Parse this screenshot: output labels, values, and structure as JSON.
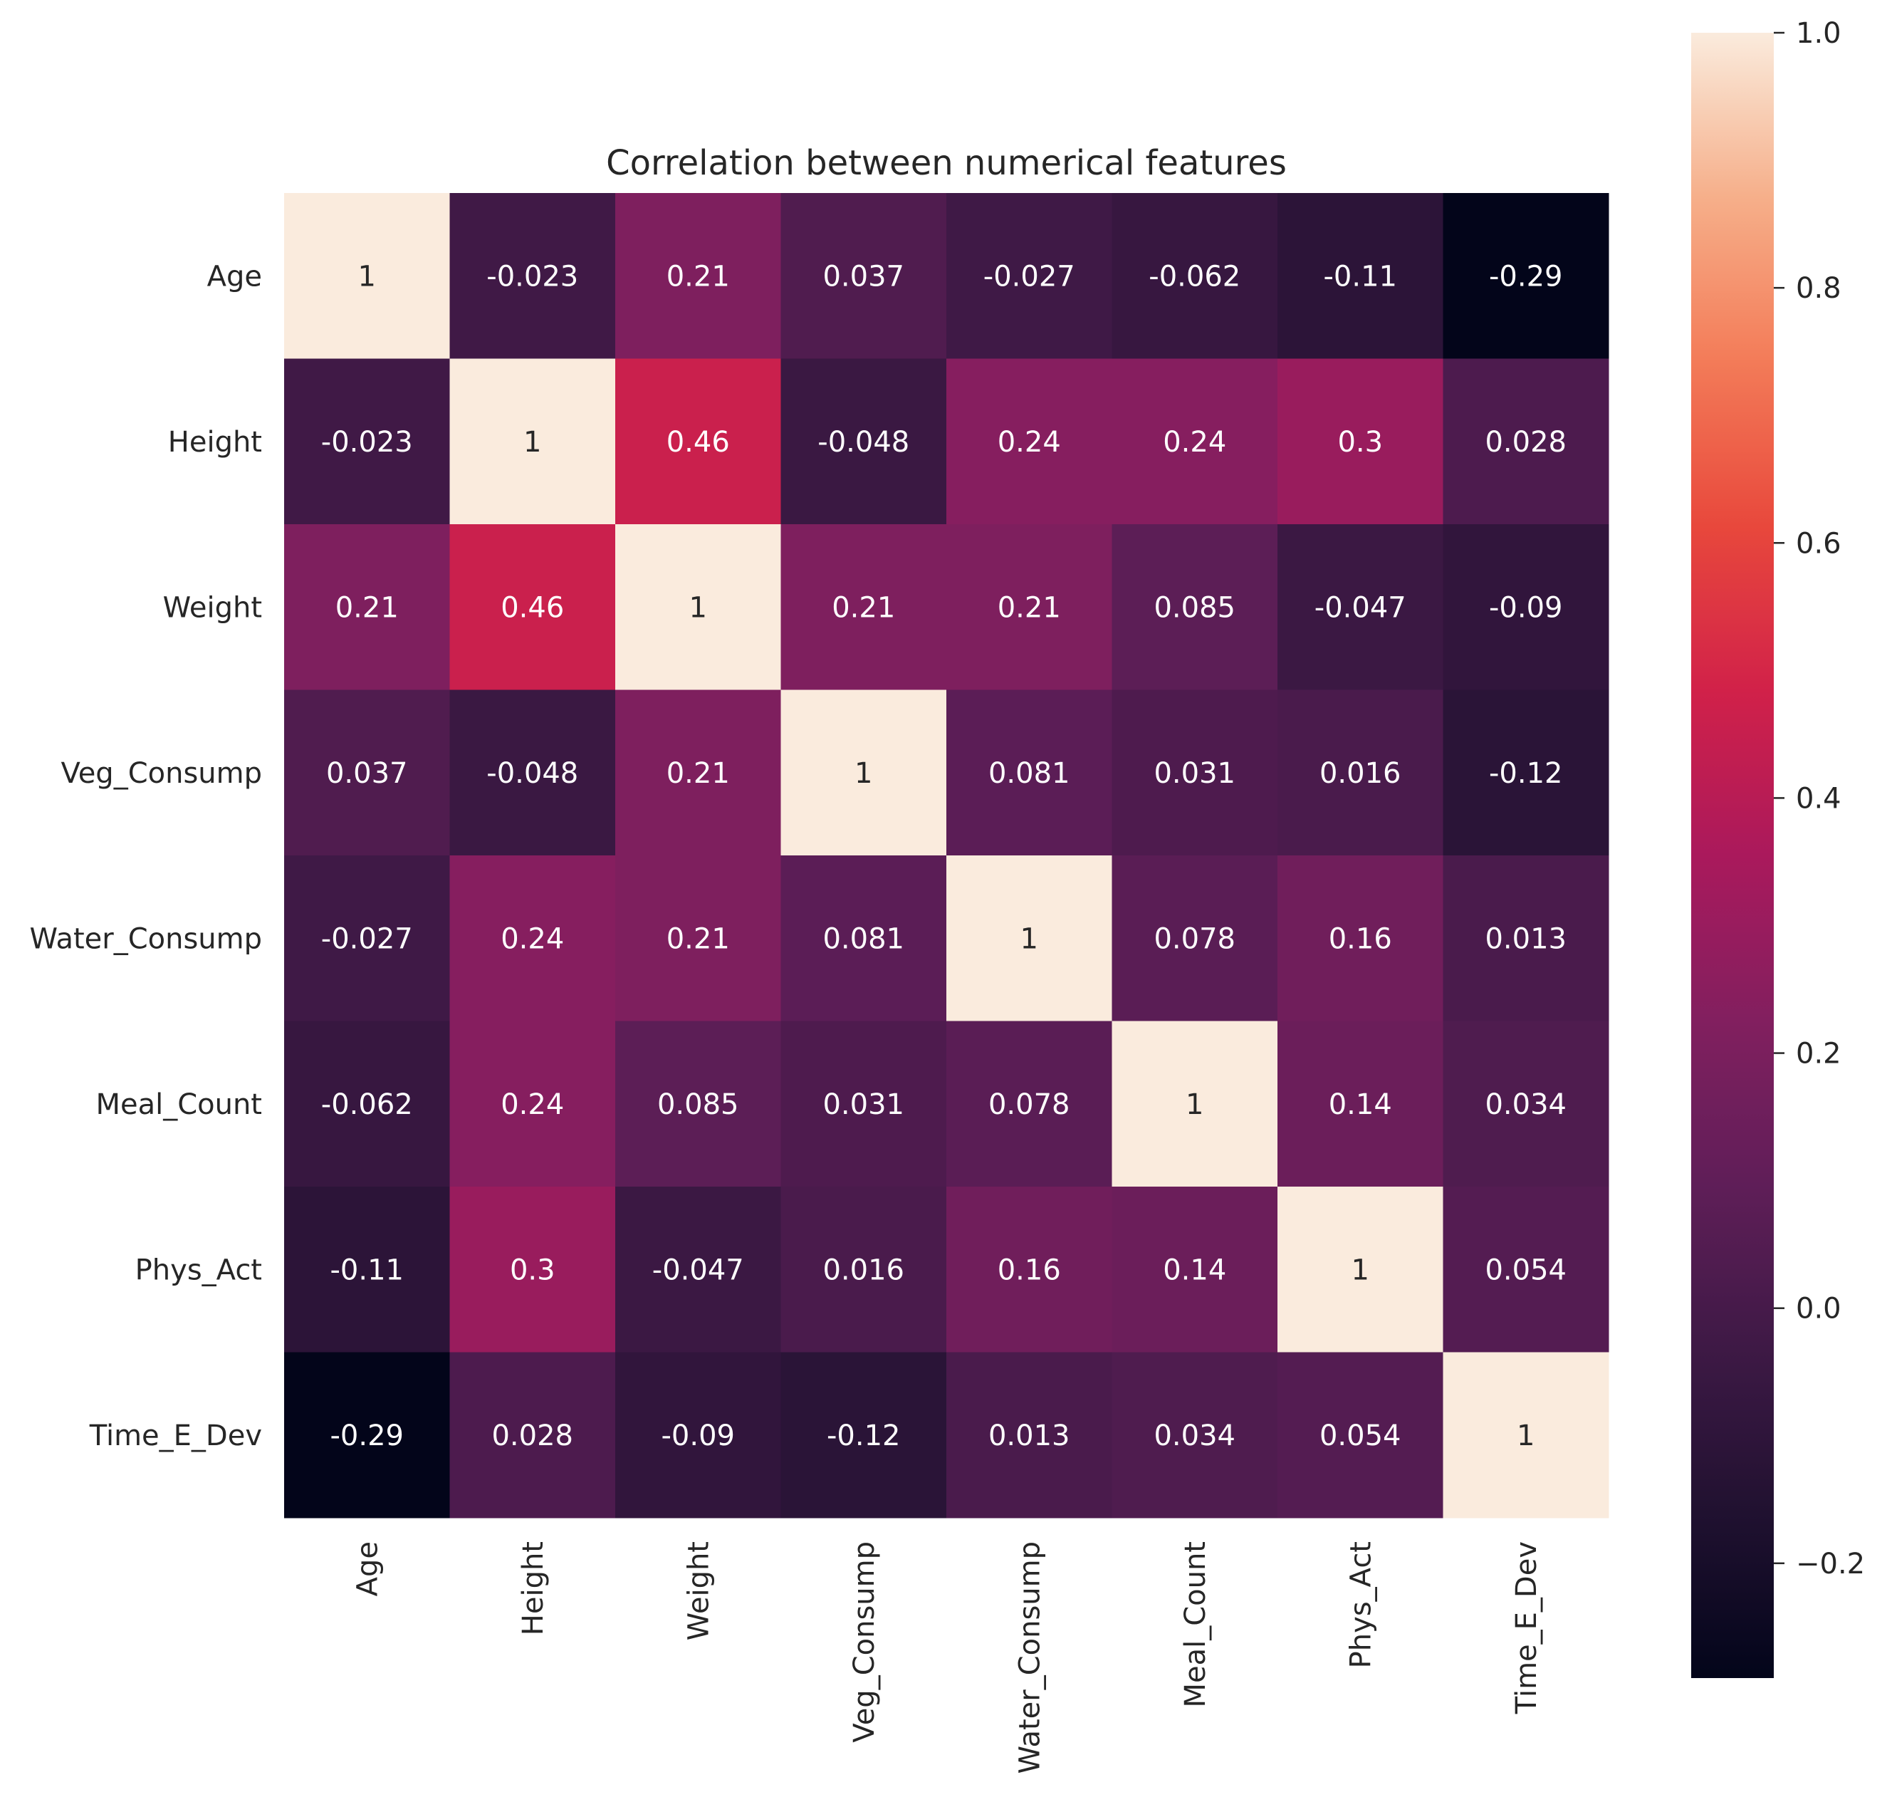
{
  "chart_data": {
    "type": "heatmap",
    "title": "Correlation between numerical features",
    "xlabel": "",
    "ylabel": "",
    "x_categories": [
      "Age",
      "Height",
      "Weight",
      "Veg_Consump",
      "Water_Consump",
      "Meal_Count",
      "Phys_Act",
      "Time_E_Dev"
    ],
    "y_categories": [
      "Age",
      "Height",
      "Weight",
      "Veg_Consump",
      "Water_Consump",
      "Meal_Count",
      "Phys_Act",
      "Time_E_Dev"
    ],
    "values": [
      [
        1,
        -0.023,
        0.21,
        0.037,
        -0.027,
        -0.062,
        -0.11,
        -0.29
      ],
      [
        -0.023,
        1,
        0.46,
        -0.048,
        0.24,
        0.24,
        0.3,
        0.028
      ],
      [
        0.21,
        0.46,
        1,
        0.21,
        0.21,
        0.085,
        -0.047,
        -0.09
      ],
      [
        0.037,
        -0.048,
        0.21,
        1,
        0.081,
        0.031,
        0.016,
        -0.12
      ],
      [
        -0.027,
        0.24,
        0.21,
        0.081,
        1,
        0.078,
        0.16,
        0.013
      ],
      [
        -0.062,
        0.24,
        0.085,
        0.031,
        0.078,
        1,
        0.14,
        0.034
      ],
      [
        -0.11,
        0.3,
        -0.047,
        0.016,
        0.16,
        0.14,
        1,
        0.054
      ],
      [
        -0.29,
        0.028,
        -0.09,
        -0.12,
        0.013,
        0.034,
        0.054,
        1
      ]
    ],
    "cell_labels": [
      [
        "1",
        "-0.023",
        "0.21",
        "0.037",
        "-0.027",
        "-0.062",
        "-0.11",
        "-0.29"
      ],
      [
        "-0.023",
        "1",
        "0.46",
        "-0.048",
        "0.24",
        "0.24",
        "0.3",
        "0.028"
      ],
      [
        "0.21",
        "0.46",
        "1",
        "0.21",
        "0.21",
        "0.085",
        "-0.047",
        "-0.09"
      ],
      [
        "0.037",
        "-0.048",
        "0.21",
        "1",
        "0.081",
        "0.031",
        "0.016",
        "-0.12"
      ],
      [
        "-0.027",
        "0.24",
        "0.21",
        "0.081",
        "1",
        "0.078",
        "0.16",
        "0.013"
      ],
      [
        "-0.062",
        "0.24",
        "0.085",
        "0.031",
        "0.078",
        "1",
        "0.14",
        "0.034"
      ],
      [
        "-0.11",
        "0.3",
        "-0.047",
        "0.016",
        "0.16",
        "0.14",
        "1",
        "0.054"
      ],
      [
        "-0.29",
        "0.028",
        "-0.09",
        "-0.12",
        "0.013",
        "0.034",
        "0.054",
        "1"
      ]
    ],
    "colormap": "rocket",
    "colorbar": {
      "range": [
        -0.29,
        1.0
      ],
      "ticks": [
        1.0,
        0.8,
        0.6,
        0.4,
        0.2,
        0.0,
        -0.2
      ],
      "tick_labels": [
        "1.0",
        "0.8",
        "0.6",
        "0.4",
        "0.2",
        "0.0",
        "−0.2"
      ],
      "placement": "right"
    },
    "annotation_colors": {
      "light_cell_text": "#262626",
      "dark_cell_text": "#ffffff"
    },
    "grid": false,
    "square_cells": true
  }
}
